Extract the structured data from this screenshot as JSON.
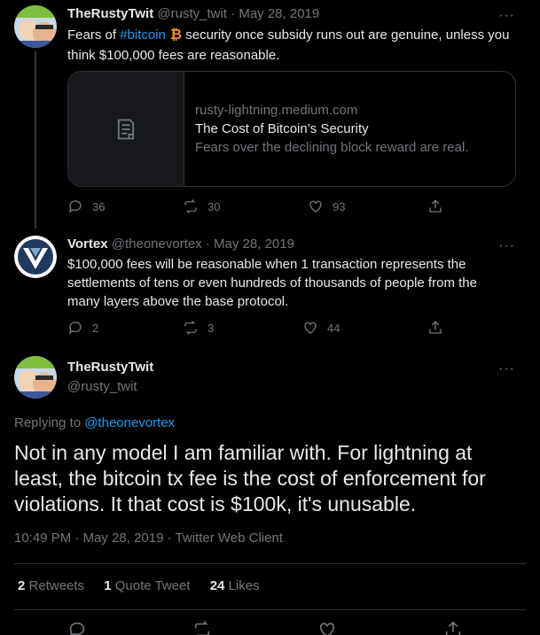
{
  "tweets": [
    {
      "name": "TheRustyTwit",
      "handle": "@rusty_twit",
      "dot": "·",
      "date": "May 28, 2019",
      "text_pre": "Fears of ",
      "hashtag": "#bitcoin",
      "text_post": " security once subsidy runs out are genuine, unless you think $100,000 fees are reasonable.",
      "card": {
        "domain": "rusty-lightning.medium.com",
        "title": "The Cost of Bitcoin’s Security",
        "description": "Fears over the declining block reward are real."
      },
      "replies": "36",
      "retweets": "30",
      "likes": "93"
    },
    {
      "name": "Vortex",
      "handle": "@theonevortex",
      "dot": "·",
      "date": "May 28, 2019",
      "text": "$100,000 fees will be reasonable when 1 transaction represents the settlements of tens or even hundreds of thousands of people from the many layers above the base protocol.",
      "replies": "2",
      "retweets": "3",
      "likes": "44"
    }
  ],
  "main": {
    "name": "TheRustyTwit",
    "handle": "@rusty_twit",
    "replying_to_label": "Replying to",
    "replying_to_handle": "@theonevortex",
    "text": "Not in any model I am familiar with.  For lightning at least, the bitcoin tx fee is the cost of enforcement for violations.  It that cost is $100k, it's unusable.",
    "time": "10:49 PM",
    "dot": "·",
    "date": "May 28, 2019",
    "client": "Twitter Web Client",
    "retweets_count": "2",
    "retweets_label": "Retweets",
    "quotes_count": "1",
    "quotes_label": "Quote Tweet",
    "likes_count": "24",
    "likes_label": "Likes"
  },
  "more_label": "···",
  "avatar_badge_text": "Bitcoin",
  "colors": {
    "background": "#000000",
    "text": "#e7e9ea",
    "muted": "#71767b",
    "link": "#1d9bf0",
    "bitcoin_orange": "#f7931a",
    "border": "#2f3336"
  }
}
